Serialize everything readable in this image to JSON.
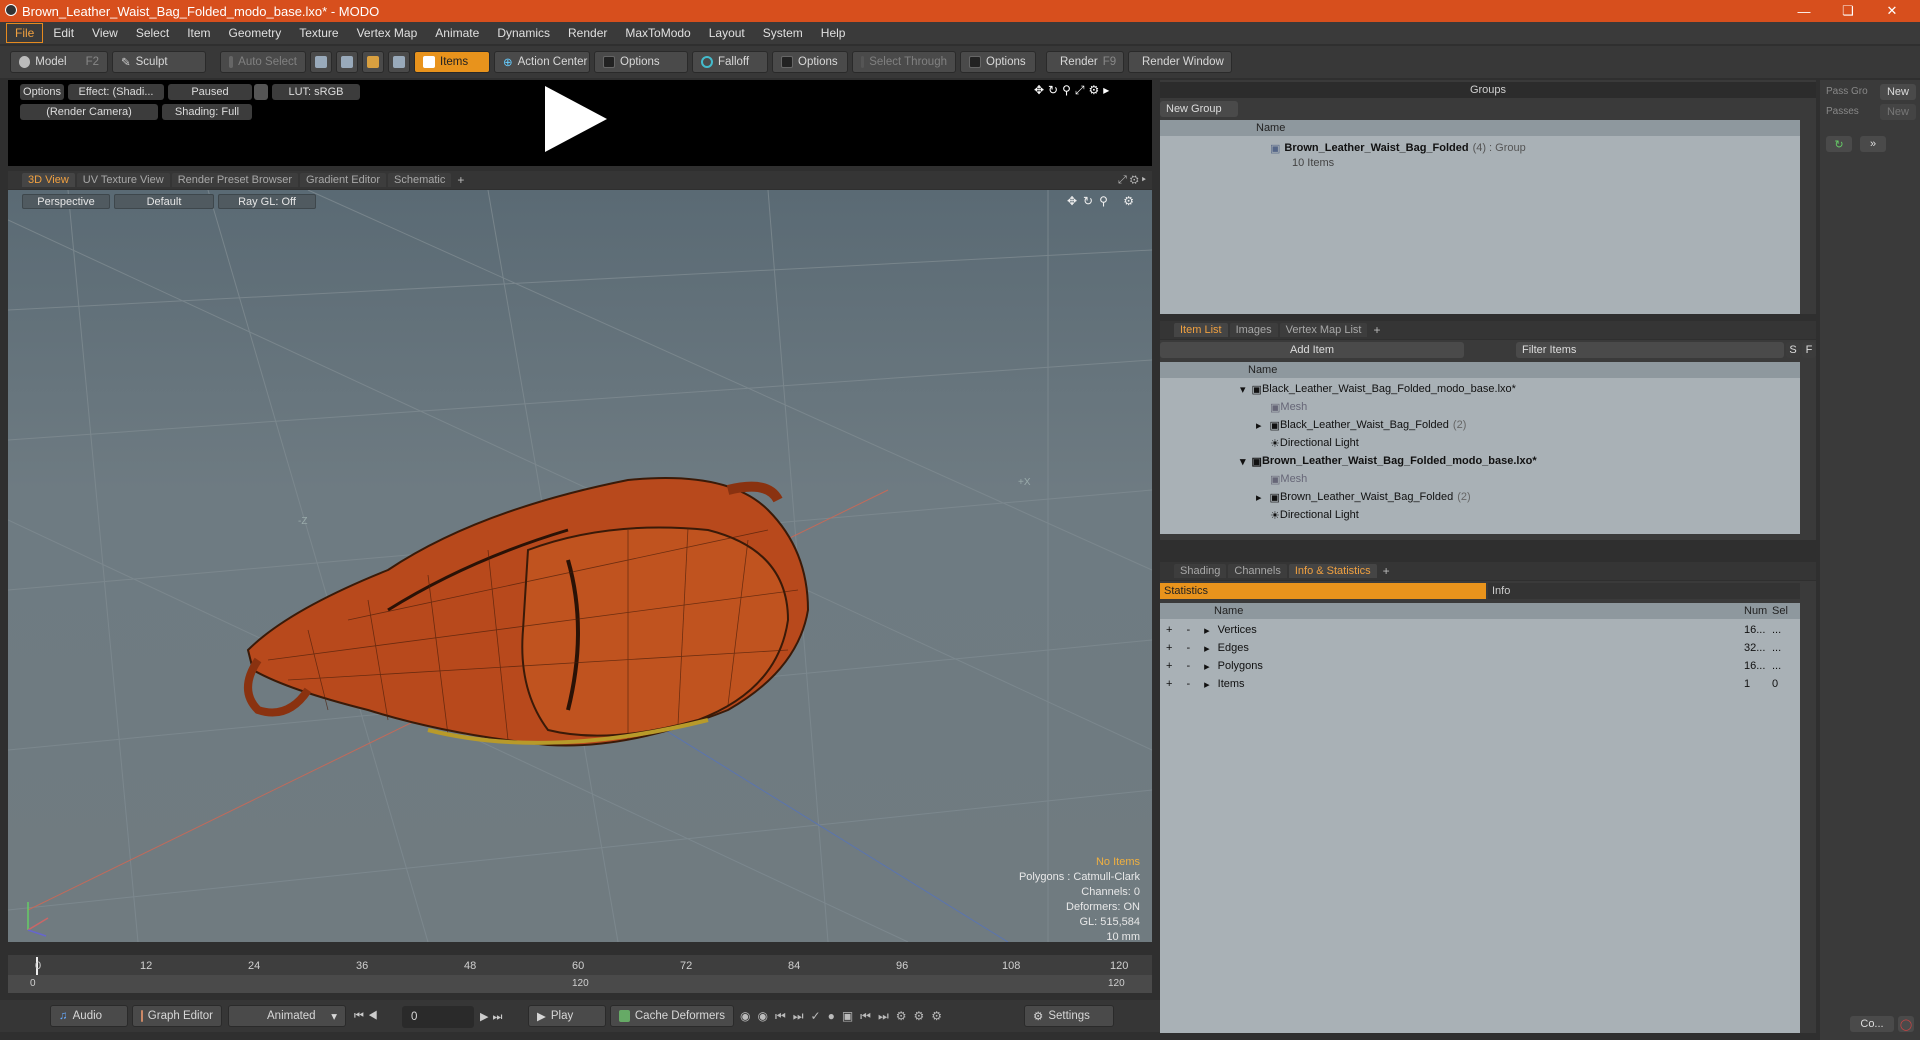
{
  "window": {
    "title": "Brown_Leather_Waist_Bag_Folded_modo_base.lxo* - MODO"
  },
  "menu": [
    "File",
    "Edit",
    "View",
    "Select",
    "Item",
    "Geometry",
    "Texture",
    "Vertex Map",
    "Animate",
    "Dynamics",
    "Render",
    "MaxToModo",
    "Layout",
    "System",
    "Help"
  ],
  "toolbar": {
    "model": "Model",
    "model_key": "F2",
    "sculpt": "Sculpt",
    "auto_select": "Auto Select",
    "items": "Items",
    "action_center": "Action Center",
    "options1": "Options",
    "falloff": "Falloff",
    "options2": "Options",
    "select_through": "Select Through",
    "options3": "Options",
    "render": "Render",
    "render_key": "F9",
    "render_window": "Render Window"
  },
  "preview": {
    "options": "Options",
    "effect": "Effect: (Shadi...",
    "paused": "Paused",
    "lut": "LUT: sRGB",
    "camera": "(Render Camera)",
    "shading": "Shading: Full"
  },
  "viewtabs": [
    "3D View",
    "UV Texture View",
    "Render Preset Browser",
    "Gradient Editor",
    "Schematic"
  ],
  "viewport": {
    "perspective": "Perspective",
    "default": "Default",
    "raygl": "Ray GL: Off",
    "axis_z": "-Z",
    "axis_x": "+X",
    "stats": {
      "no_items": "No Items",
      "polygons": "Polygons : Catmull-Clark",
      "channels": "Channels: 0",
      "deformers": "Deformers: ON",
      "gl": "GL: 515,584",
      "unit": "10 mm"
    }
  },
  "timeline": {
    "ticks": [
      "0",
      "12",
      "24",
      "36",
      "48",
      "60",
      "72",
      "84",
      "96",
      "108",
      "120"
    ],
    "start": "0",
    "mid": "120",
    "end": "120"
  },
  "bottom": {
    "audio": "Audio",
    "graph": "Graph Editor",
    "animated": "Animated",
    "frame": "0",
    "play": "Play",
    "cache": "Cache Deformers",
    "settings": "Settings"
  },
  "groups": {
    "title": "Groups",
    "new_group": "New Group",
    "name_col": "Name",
    "item": "Brown_Leather_Waist_Bag_Folded",
    "count": "(4)",
    "type": ": Group",
    "sub": "10 Items"
  },
  "side": {
    "pass_group": "Pass Gro",
    "passes": "Passes",
    "new1": "New",
    "new2": "New",
    "co": "Co..."
  },
  "itemlist": {
    "tabs": [
      "Item List",
      "Images",
      "Vertex Map List"
    ],
    "add_item": "Add Item",
    "filter": "Filter Items",
    "s": "S",
    "f": "F",
    "name_col": "Name",
    "rows": [
      {
        "label": "Black_Leather_Waist_Bag_Folded_modo_base.lxo*",
        "bold": false,
        "indent": 0
      },
      {
        "label": "Mesh",
        "dim": true,
        "indent": 1
      },
      {
        "label": "Black_Leather_Waist_Bag_Folded",
        "suffix": "(2)",
        "indent": 1
      },
      {
        "label": "Directional Light",
        "indent": 1
      },
      {
        "label": "Brown_Leather_Waist_Bag_Folded_modo_base.lxo*",
        "bold": true,
        "indent": 0
      },
      {
        "label": "Mesh",
        "dim": true,
        "indent": 1
      },
      {
        "label": "Brown_Leather_Waist_Bag_Folded",
        "suffix": "(2)",
        "indent": 1
      },
      {
        "label": "Directional Light",
        "indent": 1
      }
    ]
  },
  "stats": {
    "tabs": [
      "Shading",
      "Channels",
      "Info & Statistics"
    ],
    "statistics": "Statistics",
    "info": "Info",
    "name_col": "Name",
    "num_col": "Num",
    "sel_col": "Sel",
    "rows": [
      {
        "name": "Vertices",
        "num": "16...",
        "sel": "..."
      },
      {
        "name": "Edges",
        "num": "32...",
        "sel": "..."
      },
      {
        "name": "Polygons",
        "num": "16...",
        "sel": "..."
      },
      {
        "name": "Items",
        "num": "1",
        "sel": "0"
      }
    ]
  },
  "colors": {
    "accent": "#e8931c",
    "titlebar": "#d74f1d",
    "leather": "#b8491c"
  }
}
